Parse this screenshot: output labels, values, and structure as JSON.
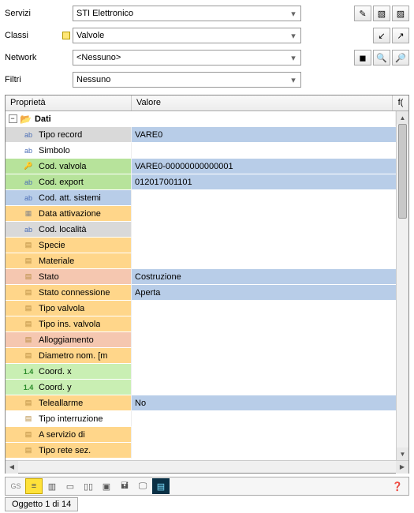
{
  "form": {
    "labels": {
      "servizi": "Servizi",
      "classi": "Classi",
      "network": "Network",
      "filtri": "Filtri"
    },
    "values": {
      "servizi": "STI Elettronico",
      "classi": "Valvole",
      "network": "<Nessuno>",
      "filtri": "Nessuno"
    }
  },
  "grid": {
    "headers": {
      "prop": "Proprietà",
      "val": "Valore",
      "fx": "f("
    },
    "group": {
      "label": "Dati"
    },
    "rows": [
      {
        "icon": "ab",
        "iconClass": "ic-ab",
        "propBg": "bg-gray",
        "prop": "Tipo record",
        "valBg": "bg-blue",
        "val": "VARE0"
      },
      {
        "icon": "ab",
        "iconClass": "ic-ab",
        "propBg": "bg-white",
        "prop": "Simbolo",
        "valBg": "bg-white",
        "val": ""
      },
      {
        "icon": "🔑",
        "iconClass": "ic-key",
        "propBg": "bg-green",
        "prop": "Cod. valvola",
        "valBg": "bg-blue",
        "val": "VARE0-00000000000001"
      },
      {
        "icon": "ab",
        "iconClass": "ic-ab",
        "propBg": "bg-green",
        "prop": "Cod. export",
        "valBg": "bg-blue",
        "val": "012017001101"
      },
      {
        "icon": "ab",
        "iconClass": "ic-ab",
        "propBg": "bg-blue",
        "prop": "Cod. att. sistemi",
        "valBg": "bg-white",
        "val": ""
      },
      {
        "icon": "▦",
        "iconClass": "ic-cal",
        "propBg": "bg-orange",
        "prop": "Data attivazione",
        "valBg": "bg-white",
        "val": ""
      },
      {
        "icon": "ab",
        "iconClass": "ic-ab",
        "propBg": "bg-gray",
        "prop": "Cod. località",
        "valBg": "bg-white",
        "val": ""
      },
      {
        "icon": "▤",
        "iconClass": "ic-doc",
        "propBg": "bg-orange",
        "prop": "Specie",
        "valBg": "bg-white",
        "val": ""
      },
      {
        "icon": "▤",
        "iconClass": "ic-doc",
        "propBg": "bg-orange",
        "prop": "Materiale",
        "valBg": "bg-white",
        "val": ""
      },
      {
        "icon": "▤",
        "iconClass": "ic-doc",
        "propBg": "bg-salmon",
        "prop": "Stato",
        "valBg": "bg-blue",
        "val": "Costruzione"
      },
      {
        "icon": "▤",
        "iconClass": "ic-doc",
        "propBg": "bg-orange",
        "prop": "Stato connessione",
        "valBg": "bg-blue",
        "val": "Aperta"
      },
      {
        "icon": "▤",
        "iconClass": "ic-doc",
        "propBg": "bg-orange",
        "prop": "Tipo valvola",
        "valBg": "bg-white",
        "val": ""
      },
      {
        "icon": "▤",
        "iconClass": "ic-doc",
        "propBg": "bg-orange",
        "prop": "Tipo ins. valvola",
        "valBg": "bg-white",
        "val": ""
      },
      {
        "icon": "▤",
        "iconClass": "ic-doc",
        "propBg": "bg-salmon",
        "prop": "Alloggiamento",
        "valBg": "bg-white",
        "val": ""
      },
      {
        "icon": "▤",
        "iconClass": "ic-doc",
        "propBg": "bg-orange",
        "prop": "Diametro nom. [m",
        "valBg": "bg-white",
        "val": ""
      },
      {
        "icon": "1.4",
        "iconClass": "ic-num",
        "propBg": "bg-greenL",
        "prop": "Coord. x",
        "valBg": "bg-white",
        "val": ""
      },
      {
        "icon": "1.4",
        "iconClass": "ic-num",
        "propBg": "bg-greenL",
        "prop": "Coord. y",
        "valBg": "bg-white",
        "val": ""
      },
      {
        "icon": "▤",
        "iconClass": "ic-doc",
        "propBg": "bg-orange",
        "prop": "Teleallarme",
        "valBg": "bg-blue",
        "val": "No"
      },
      {
        "icon": "▤",
        "iconClass": "ic-doc",
        "propBg": "bg-white",
        "prop": "Tipo interruzione",
        "valBg": "bg-white",
        "val": ""
      },
      {
        "icon": "▤",
        "iconClass": "ic-doc",
        "propBg": "bg-orange",
        "prop": "A servizio di",
        "valBg": "bg-white",
        "val": ""
      },
      {
        "icon": "▤",
        "iconClass": "ic-doc",
        "propBg": "bg-orange",
        "prop": "Tipo rete sez.",
        "valBg": "bg-white",
        "val": ""
      }
    ]
  },
  "status": {
    "text": "Oggetto 1 di 14"
  },
  "bottomToolbar": {
    "gs": "GS"
  }
}
